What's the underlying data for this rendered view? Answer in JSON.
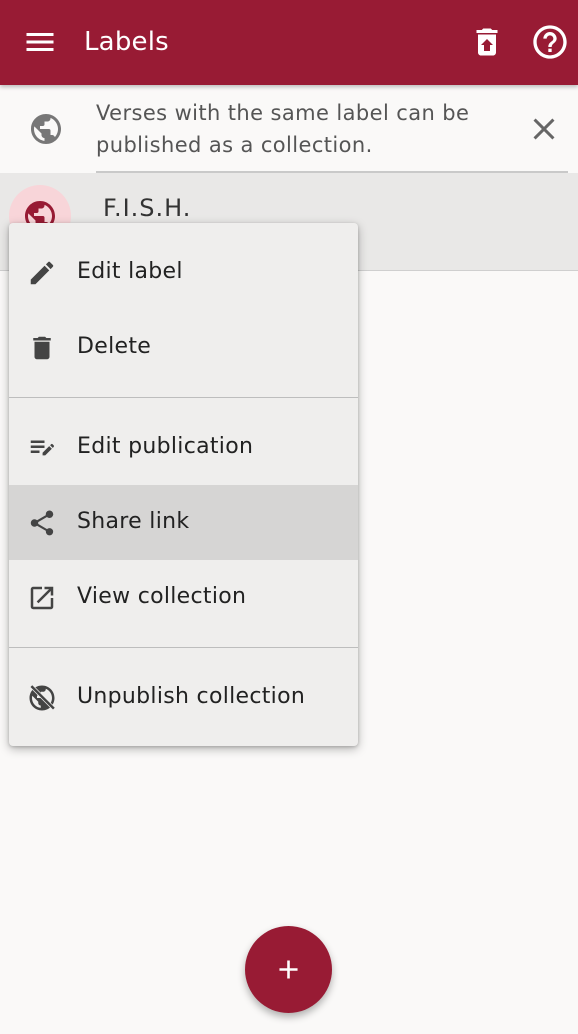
{
  "appbar": {
    "title": "Labels",
    "background": "#981b34",
    "icons": [
      "menu-icon",
      "archive-upload-icon",
      "help-icon"
    ]
  },
  "banner": {
    "text": "Verses with the same label can be published as a collection.",
    "icons": [
      "globe-icon",
      "close-icon"
    ]
  },
  "label_row": {
    "name": "F.I.S.H.",
    "avatar_color": "#f8d5d9",
    "icon": "globe-icon"
  },
  "popup_menu": {
    "items": [
      {
        "label": "Edit label",
        "icon": "pencil-icon",
        "highlighted": false
      },
      {
        "label": "Delete",
        "icon": "trash-icon",
        "highlighted": false
      },
      {
        "label": "Edit publication",
        "icon": "edit-list-icon",
        "highlighted": false
      },
      {
        "label": "Share link",
        "icon": "share-icon",
        "highlighted": true
      },
      {
        "label": "View collection",
        "icon": "open-external-icon",
        "highlighted": false
      },
      {
        "label": "Unpublish collection",
        "icon": "globe-off-icon",
        "highlighted": false
      }
    ]
  },
  "fab": {
    "icon": "plus-icon",
    "color": "#981b34"
  }
}
